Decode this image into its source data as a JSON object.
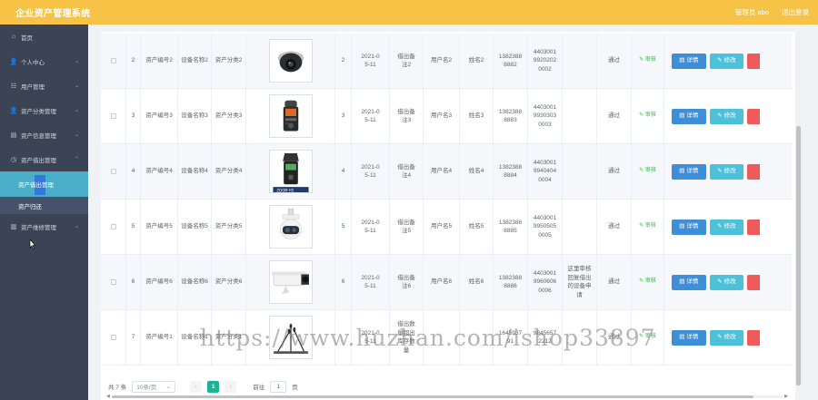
{
  "header": {
    "title": "企业资产管理系统",
    "admin_label": "管理员 abo",
    "logout_label": "退出登录"
  },
  "sidebar": {
    "items": [
      {
        "label": "首页",
        "icon": "home-icon",
        "glyph": "⌂"
      },
      {
        "label": "个人中心",
        "icon": "user-icon",
        "glyph": "👤"
      },
      {
        "label": "用户管理",
        "icon": "users-icon",
        "glyph": "☷"
      },
      {
        "label": "资产分类管理",
        "icon": "category-icon",
        "glyph": "👤"
      },
      {
        "label": "资产信息管理",
        "icon": "info-icon",
        "glyph": "▤"
      },
      {
        "label": "资产借出管理",
        "icon": "lend-icon",
        "glyph": "◷"
      }
    ],
    "sub_items": [
      {
        "label": "资产借出管理"
      },
      {
        "label": "资产归还"
      }
    ],
    "last_item": {
      "label": "资产维修管理",
      "icon": "repair-icon",
      "glyph": "▥"
    }
  },
  "table": {
    "rows": [
      {
        "idx": "2",
        "asset_no": "资产编号2",
        "device": "设备名称2",
        "category": "资产分类2",
        "image": "dome-camera",
        "qty": "2",
        "date": "2021-05-11",
        "remark": "借出备注2",
        "user": "用户名2",
        "name": "姓名2",
        "phone": "13823888882",
        "idcard": "440300199202020002",
        "reason": "",
        "status": "通过",
        "audit": "审核"
      },
      {
        "idx": "3",
        "asset_no": "资产编号3",
        "device": "设备名称3",
        "category": "资产分类3",
        "image": "recorder",
        "qty": "3",
        "date": "2021-05-11",
        "remark": "借出备注3",
        "user": "用户名3",
        "name": "姓名3",
        "phone": "13823888883",
        "idcard": "440300199303030003",
        "reason": "",
        "status": "通过",
        "audit": "审核"
      },
      {
        "idx": "4",
        "asset_no": "资产编号4",
        "device": "设备名称4",
        "category": "资产分类4",
        "image": "zoom-recorder",
        "qty": "4",
        "date": "2021-05-11",
        "remark": "借出备注4",
        "user": "用户名4",
        "name": "姓名4",
        "phone": "13823888884",
        "idcard": "440300199404040004",
        "reason": "",
        "status": "通过",
        "audit": "审核"
      },
      {
        "idx": "5",
        "asset_no": "资产编号5",
        "device": "设备名称5",
        "category": "资产分类5",
        "image": "ptz-camera",
        "qty": "5",
        "date": "2021-05-11",
        "remark": "借出备注5",
        "user": "用户名5",
        "name": "姓名5",
        "phone": "13823888885",
        "idcard": "440300199505050005",
        "reason": "",
        "status": "通过",
        "audit": "审核"
      },
      {
        "idx": "6",
        "asset_no": "资产编号6",
        "device": "设备名称6",
        "category": "资产分类6",
        "image": "bullet-camera",
        "qty": "6",
        "date": "2021-05-11",
        "remark": "借出备注6",
        "user": "用户名6",
        "name": "姓名6",
        "phone": "13823888886",
        "idcard": "440300199606060006",
        "reason": "这里审核回复借出的设备申请",
        "status": "通过",
        "audit": "审核"
      },
      {
        "idx": "7",
        "asset_no": "资产编号1",
        "device": "设备名称1",
        "category": "资产分类1",
        "image": "microphones",
        "qty": "",
        "date": "2021-05-11",
        "remark": "借出数量超出库存数量",
        "user": "",
        "name": "",
        "phone": "164598791",
        "idcard": "98456572212",
        "reason": "",
        "status": "通过",
        "audit": "审核"
      }
    ],
    "detail_label": "详情",
    "edit_label": "修改"
  },
  "pagination": {
    "total": "共 7 条",
    "page_size": "10条/页",
    "current_page": "1",
    "goto_label": "前往",
    "goto_value": "1",
    "page_unit": "页"
  },
  "watermark": "https://www.huzhan.com/ishop33897"
}
